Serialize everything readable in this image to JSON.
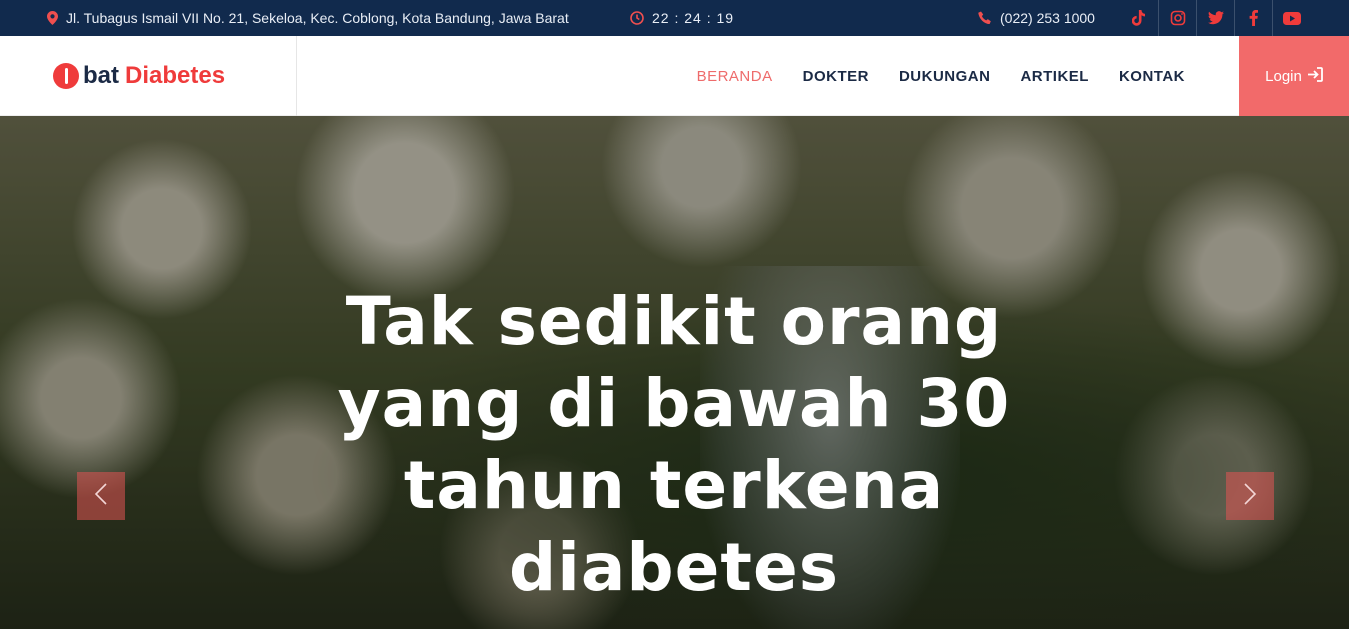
{
  "topbar": {
    "address": "Jl. Tubagus Ismail VII No. 21, Sekeloa, Kec. Coblong, Kota Bandung, Jawa Barat",
    "time": "22 : 24 : 19",
    "phone": "(022) 253 1000",
    "social": [
      {
        "icon": "tiktok-icon",
        "color": "#ef3b3b"
      },
      {
        "icon": "instagram-icon",
        "color": "#ef3b3b"
      },
      {
        "icon": "twitter-icon",
        "color": "#ef3b3b"
      },
      {
        "icon": "facebook-icon",
        "color": "#ef3b3b"
      },
      {
        "icon": "youtube-icon",
        "color": "#ef3b3b"
      }
    ]
  },
  "brand": {
    "part1": "bat",
    "part2": "Diabetes",
    "accent_color": "#ef3b3b"
  },
  "nav": {
    "items": [
      {
        "label": "BERANDA",
        "active": true
      },
      {
        "label": "DOKTER",
        "active": false
      },
      {
        "label": "DUKUNGAN",
        "active": false
      },
      {
        "label": "ARTIKEL",
        "active": false
      },
      {
        "label": "KONTAK",
        "active": false
      }
    ],
    "login_label": "Login",
    "active_color": "#ee6b6b"
  },
  "hero": {
    "headline": "Tak sedikit orang yang di bawah 30 tahun terkena diabetes"
  },
  "colors": {
    "topbar_bg": "#112a4d",
    "login_bg": "#f26a6a",
    "text_dark": "#1b2a45"
  }
}
